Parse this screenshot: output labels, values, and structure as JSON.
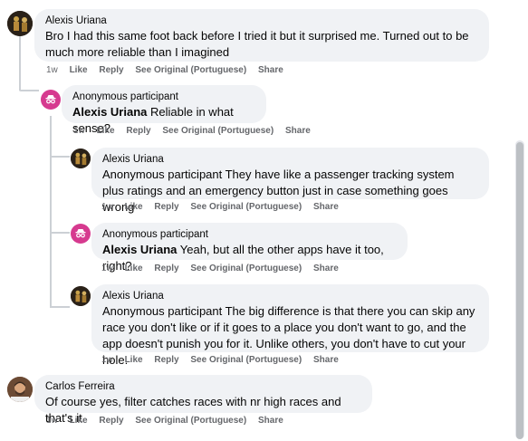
{
  "comments": [
    {
      "author": "Alexis Uriana",
      "mention": "",
      "text": "Bro I had this same foot back before I tried it but it surprised me. Turned out to be much more reliable than I imagined",
      "time": "1w"
    },
    {
      "author": "Anonymous participant",
      "mention": "Alexis Uriana",
      "text": " Reliable in what sense?",
      "time": "1w"
    },
    {
      "author": "Alexis Uriana",
      "mention": "",
      "text": "Anonymous participant They have like a passenger tracking system plus ratings and an emergency button just in case something goes wrong",
      "time": "1w"
    },
    {
      "author": "Anonymous participant",
      "mention": "Alexis Uriana",
      "text": " Yeah, but all the other apps have it too, right?",
      "time": "1w"
    },
    {
      "author": "Alexis Uriana",
      "mention": "",
      "text": "Anonymous participant The big difference is that there you can skip any race you don't like or if it goes to a place you don't want to go, and the app doesn't punish you for it. Unlike others, you don't have to cut your hole.",
      "time": "1w"
    },
    {
      "author": "Carlos Ferreira",
      "mention": "",
      "text": "Of course yes, filter catches races with nr high races and that's it",
      "time": "1w"
    }
  ],
  "actions": {
    "like": "Like",
    "reply": "Reply",
    "see_original": "See Original (Portuguese)",
    "share": "Share"
  },
  "colors": {
    "bubble": "#f0f2f5",
    "anon_avatar": "#d63a8f",
    "meta_text": "#65676b"
  }
}
